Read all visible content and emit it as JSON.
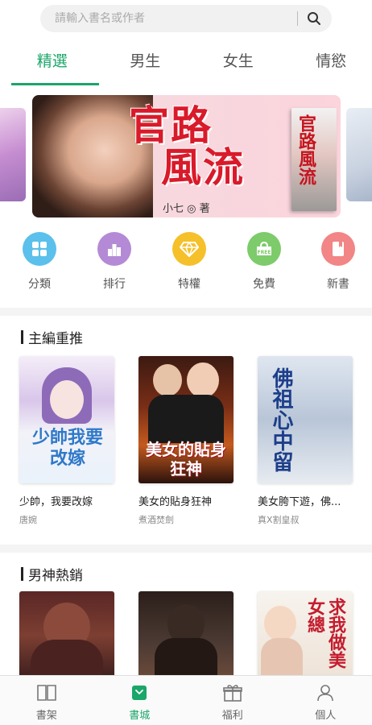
{
  "search": {
    "placeholder": "請輸入書名或作者"
  },
  "tabs": [
    {
      "label": "精選",
      "active": true
    },
    {
      "label": "男生"
    },
    {
      "label": "女生"
    },
    {
      "label": "情慾"
    }
  ],
  "banner": {
    "title_line1": "官路",
    "title_line2": "風流",
    "author": "小七 ◎ 著",
    "book_title": "官路風流"
  },
  "categories": [
    {
      "label": "分類",
      "icon": "grid-icon",
      "color": "#5bc0eb"
    },
    {
      "label": "排行",
      "icon": "ranking-icon",
      "color": "#b48ad6"
    },
    {
      "label": "特權",
      "icon": "diamond-icon",
      "color": "#f5c02a"
    },
    {
      "label": "免費",
      "icon": "free-icon",
      "color": "#7dcb6a"
    },
    {
      "label": "新書",
      "icon": "new-book-icon",
      "color": "#f28585"
    }
  ],
  "sections": [
    {
      "title": "主編重推",
      "books": [
        {
          "title": "少帥，我要改嫁",
          "author": "唐婉",
          "cover_text": "少帥我要改嫁"
        },
        {
          "title": "美女的貼身狂神",
          "author": "煮酒焚劍",
          "cover_text": "美女的貼身狂神"
        },
        {
          "title": "美女胯下遊，佛...",
          "author": "真X割皇叔",
          "cover_text": "佛祖心中留"
        }
      ]
    },
    {
      "title": "男神熱銷",
      "books": [
        {
          "cover_text": ""
        },
        {
          "cover_text": ""
        },
        {
          "cover_text": "求我做美女總"
        }
      ]
    }
  ],
  "bottom_nav": [
    {
      "label": "書架",
      "icon": "bookshelf-icon",
      "active": false
    },
    {
      "label": "書城",
      "icon": "bookstore-icon",
      "active": true
    },
    {
      "label": "福利",
      "icon": "gift-icon",
      "active": false
    },
    {
      "label": "個人",
      "icon": "person-icon",
      "active": false
    }
  ],
  "colors": {
    "accent": "#1ba66a",
    "text": "#333333",
    "muted": "#888888"
  }
}
